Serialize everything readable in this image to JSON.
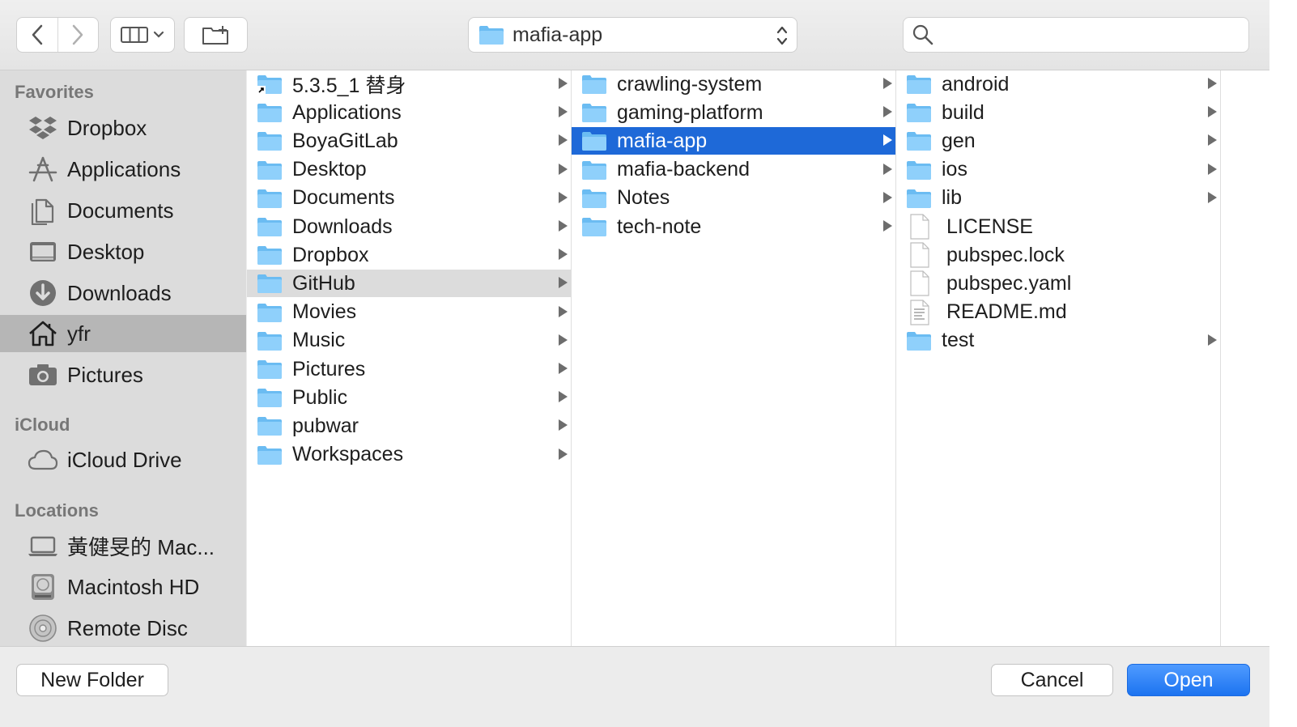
{
  "toolbar": {
    "location": "mafia-app",
    "search_value": "",
    "search_placeholder": ""
  },
  "sidebar": {
    "favorites_header": "Favorites",
    "favorites": [
      {
        "label": "Dropbox",
        "icon": "dropbox-icon"
      },
      {
        "label": "Applications",
        "icon": "applications-icon"
      },
      {
        "label": "Documents",
        "icon": "documents-icon"
      },
      {
        "label": "Desktop",
        "icon": "desktop-icon"
      },
      {
        "label": "Downloads",
        "icon": "downloads-icon"
      },
      {
        "label": "yfr",
        "icon": "home-icon",
        "selected": true
      },
      {
        "label": "Pictures",
        "icon": "camera-icon"
      }
    ],
    "icloud_header": "iCloud",
    "icloud": [
      {
        "label": "iCloud Drive",
        "icon": "cloud-icon"
      }
    ],
    "locations_header": "Locations",
    "locations": [
      {
        "label": "黃健旻的 Mac...",
        "icon": "laptop-icon"
      },
      {
        "label": "Macintosh HD",
        "icon": "hard-drive-icon"
      },
      {
        "label": "Remote Disc",
        "icon": "disc-icon"
      }
    ]
  },
  "columns": [
    [
      {
        "name": "5.3.5_1 替身",
        "type": "folder-alias",
        "arrow": true
      },
      {
        "name": "Applications",
        "type": "folder",
        "arrow": true
      },
      {
        "name": "BoyaGitLab",
        "type": "folder",
        "arrow": true
      },
      {
        "name": "Desktop",
        "type": "folder",
        "arrow": true
      },
      {
        "name": "Documents",
        "type": "folder",
        "arrow": true
      },
      {
        "name": "Downloads",
        "type": "folder",
        "arrow": true
      },
      {
        "name": "Dropbox",
        "type": "folder",
        "arrow": true
      },
      {
        "name": "GitHub",
        "type": "folder",
        "arrow": true,
        "state": "path"
      },
      {
        "name": "Movies",
        "type": "folder",
        "arrow": true
      },
      {
        "name": "Music",
        "type": "folder",
        "arrow": true
      },
      {
        "name": "Pictures",
        "type": "folder",
        "arrow": true
      },
      {
        "name": "Public",
        "type": "folder",
        "arrow": true
      },
      {
        "name": "pubwar",
        "type": "folder",
        "arrow": true
      },
      {
        "name": "Workspaces",
        "type": "folder",
        "arrow": true
      }
    ],
    [
      {
        "name": "crawling-system",
        "type": "folder",
        "arrow": true
      },
      {
        "name": "gaming-platform",
        "type": "folder",
        "arrow": true
      },
      {
        "name": "mafia-app",
        "type": "folder",
        "arrow": true,
        "state": "selected"
      },
      {
        "name": "mafia-backend",
        "type": "folder",
        "arrow": true
      },
      {
        "name": "Notes",
        "type": "folder",
        "arrow": true
      },
      {
        "name": "tech-note",
        "type": "folder",
        "arrow": true
      }
    ],
    [
      {
        "name": "android",
        "type": "folder",
        "arrow": true
      },
      {
        "name": "build",
        "type": "folder",
        "arrow": true
      },
      {
        "name": "gen",
        "type": "folder",
        "arrow": true
      },
      {
        "name": "ios",
        "type": "folder",
        "arrow": true
      },
      {
        "name": "lib",
        "type": "folder",
        "arrow": true
      },
      {
        "name": "LICENSE",
        "type": "file",
        "arrow": false
      },
      {
        "name": "pubspec.lock",
        "type": "file",
        "arrow": false
      },
      {
        "name": "pubspec.yaml",
        "type": "file",
        "arrow": false
      },
      {
        "name": "README.md",
        "type": "text-file",
        "arrow": false
      },
      {
        "name": "test",
        "type": "folder",
        "arrow": true
      }
    ]
  ],
  "buttons": {
    "new_folder": "New Folder",
    "cancel": "Cancel",
    "open": "Open"
  },
  "colors": {
    "selection": "#1e69d8",
    "path_highlight": "#dcdcdc",
    "folder": "#6bbcf2",
    "primary_button": "#1c73f0"
  }
}
